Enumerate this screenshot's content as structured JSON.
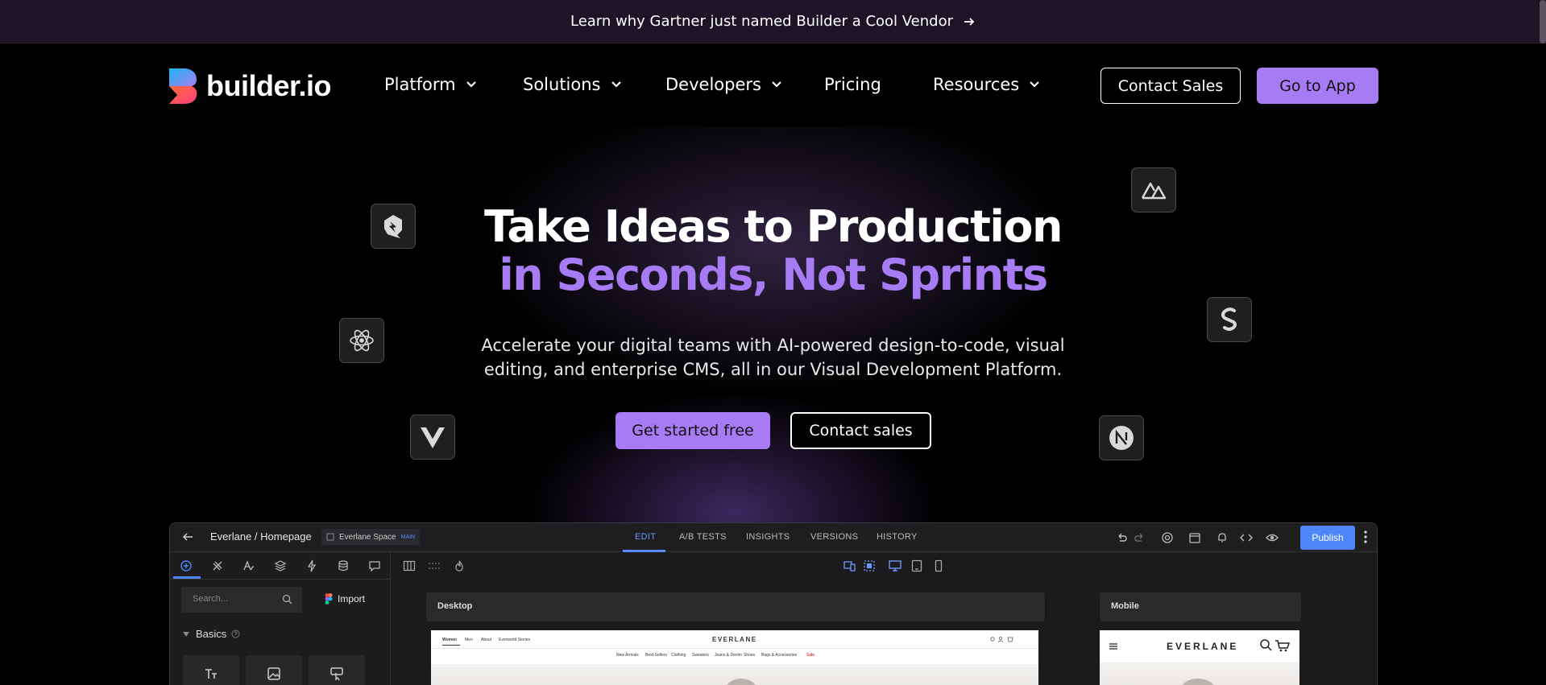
{
  "announcement": {
    "text": "Learn why Gartner just named Builder a Cool Vendor"
  },
  "nav": {
    "logo": "builder.io",
    "items": [
      {
        "label": "Platform",
        "has_dropdown": true
      },
      {
        "label": "Solutions",
        "has_dropdown": true
      },
      {
        "label": "Developers",
        "has_dropdown": true
      },
      {
        "label": "Pricing",
        "has_dropdown": false
      },
      {
        "label": "Resources",
        "has_dropdown": true
      }
    ],
    "contact_sales": "Contact Sales",
    "go_to_app": "Go to App"
  },
  "hero": {
    "title_line1": "Take Ideas to Production",
    "title_line2": "in Seconds, Not Sprints",
    "subtitle_line1": "Accelerate your digital teams with AI-powered design-to-code, visual",
    "subtitle_line2": "editing, and enterprise CMS, all in our Visual Development Platform.",
    "cta_primary": "Get started free",
    "cta_secondary": "Contact sales",
    "framework_icons": [
      "qwik-icon",
      "react-icon",
      "vue-icon",
      "nuxt-icon",
      "svelte-icon",
      "nextjs-icon"
    ]
  },
  "editor": {
    "breadcrumb": "Everlane / Homepage",
    "space": "Everlane Space",
    "space_badge": "MAIN",
    "tabs": [
      {
        "label": "EDIT",
        "active": true
      },
      {
        "label": "A/B TESTS",
        "active": false
      },
      {
        "label": "INSIGHTS",
        "active": false
      },
      {
        "label": "VERSIONS",
        "active": false
      },
      {
        "label": "HISTORY",
        "active": false
      }
    ],
    "publish": "Publish",
    "search_placeholder": "Search...",
    "import": "Import",
    "basics": "Basics",
    "frame_desktop": "Desktop",
    "frame_mobile": "Mobile",
    "preview": {
      "brand": "EVERLANE",
      "top_links": [
        "Women",
        "Men",
        "About",
        "Everworld Stories"
      ],
      "categories": [
        "New Arrivals",
        "Best-Sellers",
        "Clothing",
        "Sweaters",
        "Jeans & Denim",
        "Shoes",
        "Bags & Accessories",
        "Sale"
      ]
    }
  },
  "colors": {
    "accent": "#a77bf3",
    "publish_blue": "#4f86f7",
    "banner_bg": "#1c1528"
  }
}
